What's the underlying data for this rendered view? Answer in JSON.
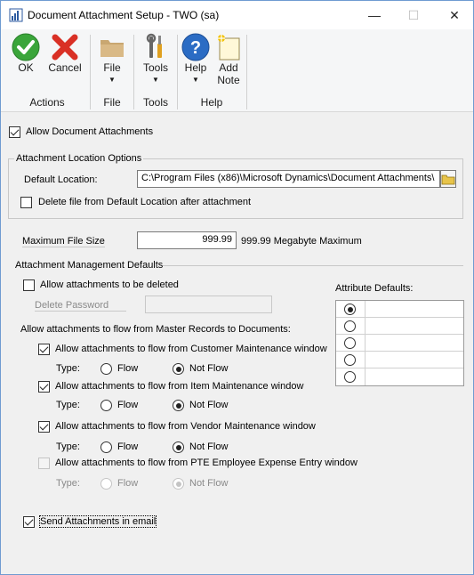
{
  "window": {
    "title": "Document Attachment Setup  -  TWO (sa)",
    "controls": {
      "minimize": "—",
      "maximize": "☐",
      "close": "✕"
    }
  },
  "ribbon": {
    "ok_label": "OK",
    "cancel_label": "Cancel",
    "file_label": "File",
    "tools_label": "Tools",
    "help_label": "Help",
    "add_note_line1": "Add",
    "add_note_line2": "Note",
    "groups": {
      "actions": "Actions",
      "file": "File",
      "tools": "Tools",
      "help": "Help"
    },
    "colors": {
      "ok_green": "#3aa53a",
      "cancel_red": "#d93025",
      "help_blue": "#2b6cc4",
      "folder_tan": "#c9a771"
    }
  },
  "form": {
    "allow_attachments": {
      "label": "Allow Document Attachments",
      "checked": true
    },
    "location_options": {
      "title": "Attachment Location Options",
      "default_location_label": "Default Location:",
      "default_location_value": "C:\\Program Files (x86)\\Microsoft Dynamics\\Document Attachments\\",
      "delete_file_label": "Delete file from Default Location after attachment",
      "delete_file_checked": false
    },
    "max_file_size": {
      "label": "Maximum File Size",
      "value": "999.99",
      "maximum_text": "999.99 Megabyte Maximum"
    },
    "management_defaults": {
      "title": "Attachment Management Defaults",
      "allow_delete_label": "Allow attachments to be deleted",
      "allow_delete_checked": false,
      "delete_password_label": "Delete Password",
      "delete_password_value": "",
      "attribute_defaults_label": "Attribute Defaults:",
      "attribute_rows": [
        {
          "selected": true,
          "value": ""
        },
        {
          "selected": false,
          "value": ""
        },
        {
          "selected": false,
          "value": ""
        },
        {
          "selected": false,
          "value": ""
        },
        {
          "selected": false,
          "value": ""
        }
      ]
    },
    "flow_section_label": "Allow attachments to flow from Master Records to Documents:",
    "type_label": "Type:",
    "flow_label": "Flow",
    "not_flow_label": "Not Flow",
    "flows": [
      {
        "label": "Allow attachments to flow from Customer Maintenance window",
        "checked": true,
        "enabled": true,
        "type": "Not Flow"
      },
      {
        "label": "Allow attachments to flow from Item Maintenance window",
        "checked": true,
        "enabled": true,
        "type": "Not Flow"
      },
      {
        "label": "Allow attachments to flow from Vendor Maintenance window",
        "checked": true,
        "enabled": true,
        "type": "Not Flow"
      },
      {
        "label": "Allow attachments to flow from PTE Employee Expense Entry window",
        "checked": false,
        "enabled": false,
        "type": "Not Flow"
      }
    ],
    "send_in_email": {
      "label": "Send Attachments in email",
      "checked": true
    }
  }
}
